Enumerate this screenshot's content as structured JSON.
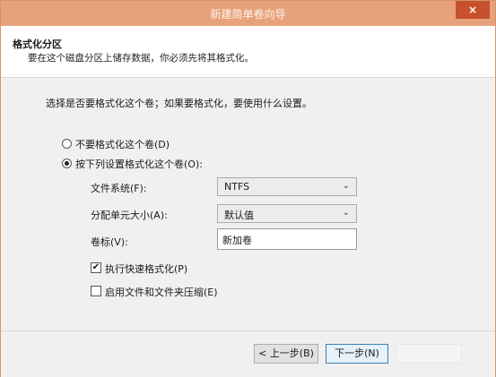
{
  "window": {
    "title": "新建简单卷向导",
    "close_label": "×"
  },
  "header": {
    "title": "格式化分区",
    "subtitle": "要在这个磁盘分区上储存数据，你必须先将其格式化。"
  },
  "content": {
    "prompt": "选择是否要格式化这个卷；如果要格式化，要使用什么设置。",
    "options": {
      "no_format": "不要格式化这个卷(D)",
      "format": "按下列设置格式化这个卷(O):"
    },
    "fields": {
      "filesystem": {
        "label": "文件系统(F):",
        "value": "NTFS"
      },
      "allocation": {
        "label": "分配单元大小(A):",
        "value": "默认值"
      },
      "volume_label": {
        "label": "卷标(V):",
        "value": "新加卷"
      }
    },
    "checks": {
      "quick_format": {
        "label": "执行快速格式化(P)",
        "checked": true
      },
      "compression": {
        "label": "启用文件和文件夹压缩(E)",
        "checked": false
      }
    }
  },
  "footer": {
    "back_label": "< 上一步(B)",
    "next_label": "下一步(N)"
  }
}
